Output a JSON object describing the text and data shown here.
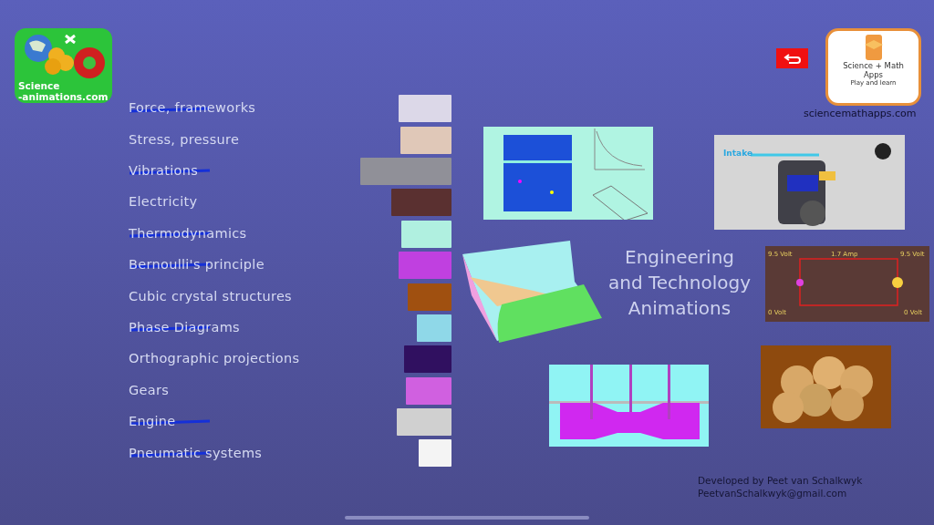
{
  "logo": {
    "line_1": "Science",
    "line_2": "-animations.com"
  },
  "topics": [
    {
      "label": "Force, frameworks",
      "struck": true
    },
    {
      "label": "Stress, pressure",
      "struck": false
    },
    {
      "label": "Vibrations",
      "struck": true
    },
    {
      "label": "Electricity",
      "struck": false
    },
    {
      "label": "Thermodynamics",
      "struck": true
    },
    {
      "label": "Bernoulli's principle",
      "struck": true
    },
    {
      "label": "Cubic crystal structures",
      "struck": false
    },
    {
      "label": "Phase Diagrams",
      "struck": true
    },
    {
      "label": "Orthographic projections",
      "struck": false
    },
    {
      "label": "Gears",
      "struck": false
    },
    {
      "label": "Engine",
      "struck": true
    },
    {
      "label": "Pneumatic systems",
      "struck": true
    }
  ],
  "app_badge": {
    "line_1": "Science + Math",
    "line_2": "Apps",
    "tagline": "Play and learn",
    "website": "sciencemathapps.com"
  },
  "title": [
    "Engineering",
    "and Technology",
    "Animations"
  ],
  "engine_picture": {
    "label": "Intake"
  },
  "circuit_picture": {
    "labels": [
      "9.5 Volt",
      "1.7 Amp",
      "9.5 Volt",
      "0 Volt",
      "0 Volt"
    ]
  },
  "credits": [
    "Developed by Peet van Schalkwyk",
    "PeetvanSchalkwyk@gmail.com"
  ]
}
